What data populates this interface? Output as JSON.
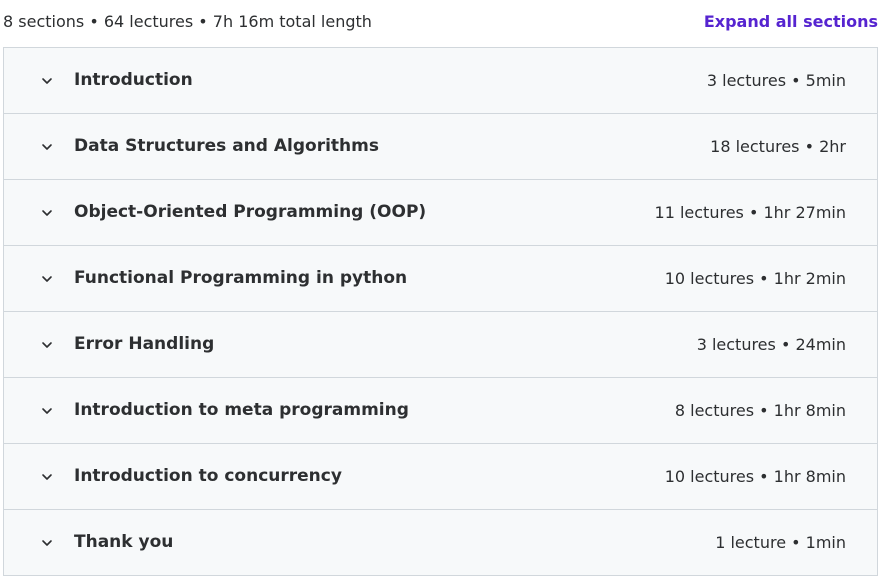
{
  "summary": {
    "text": "8 sections • 64 lectures • 7h 16m total length",
    "expand_label": "Expand all sections"
  },
  "icons": {
    "chevron": "chevron-down-icon"
  },
  "sections": [
    {
      "title": "Introduction",
      "meta": "3 lectures • 5min"
    },
    {
      "title": "Data Structures and Algorithms",
      "meta": "18 lectures • 2hr"
    },
    {
      "title": "Object-Oriented Programming (OOP)",
      "meta": "11 lectures • 1hr 27min"
    },
    {
      "title": "Functional Programming in python",
      "meta": "10 lectures • 1hr 2min"
    },
    {
      "title": "Error Handling",
      "meta": "3 lectures • 24min"
    },
    {
      "title": "Introduction to meta programming",
      "meta": "8 lectures • 1hr 8min"
    },
    {
      "title": "Introduction to concurrency",
      "meta": "10 lectures • 1hr 8min"
    },
    {
      "title": "Thank you",
      "meta": "1 lecture • 1min"
    }
  ],
  "colors": {
    "accent": "#5624d0",
    "row_bg": "#f7f9fa",
    "border": "#d1d7dc",
    "text": "#2d2f31"
  }
}
